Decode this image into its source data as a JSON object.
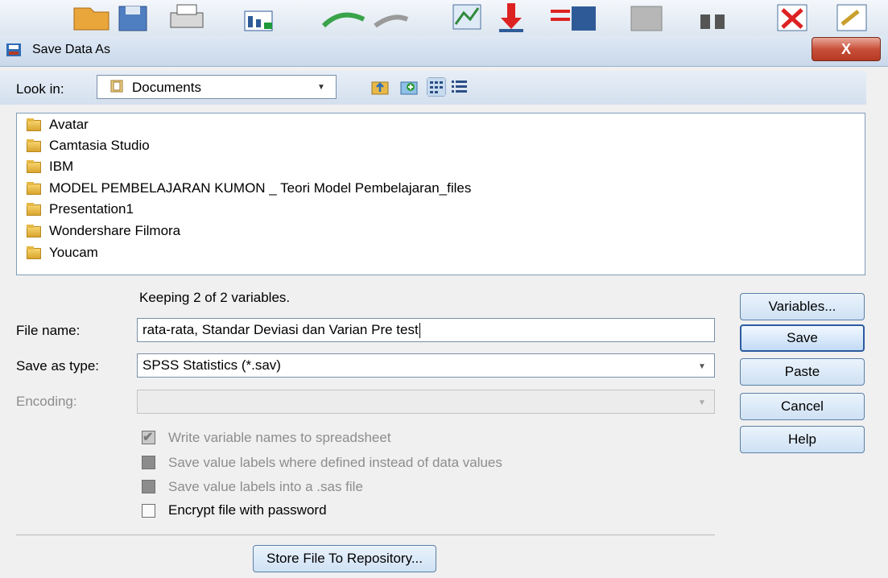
{
  "dialog": {
    "title": "Save Data As",
    "close_label": "X"
  },
  "look_in": {
    "label": "Look in:",
    "value": "Documents"
  },
  "files": [
    {
      "name": "Avatar"
    },
    {
      "name": "Camtasia Studio"
    },
    {
      "name": "IBM"
    },
    {
      "name": "MODEL PEMBELAJARAN KUMON _ Teori Model Pembelajaran_files"
    },
    {
      "name": "Presentation1"
    },
    {
      "name": "Wondershare Filmora"
    },
    {
      "name": "Youcam"
    }
  ],
  "keeping_text": "Keeping 2 of 2 variables.",
  "file_name": {
    "label": "File name:",
    "value": "rata-rata, Standar Deviasi dan Varian Pre test"
  },
  "save_type": {
    "label": "Save as type:",
    "value": "SPSS Statistics (*.sav)"
  },
  "encoding": {
    "label": "Encoding:",
    "value": ""
  },
  "options": {
    "write_names": "Write variable names to spreadsheet",
    "save_value_labels": "Save value labels where defined instead of data values",
    "save_sas_labels": "Save value labels into a .sas file",
    "encrypt": "Encrypt file with password"
  },
  "buttons": {
    "variables": "Variables...",
    "save": "Save",
    "paste": "Paste",
    "cancel": "Cancel",
    "help": "Help",
    "store_repo": "Store File To Repository..."
  },
  "icons": {
    "toolbar": [
      "open-folder-icon",
      "save-icon",
      "print-icon",
      "dialog-recall-icon",
      "undo-icon",
      "redo-icon",
      "goto-case-icon",
      "goto-variable-icon",
      "variables-icon",
      "run-descriptives-icon",
      "find-icon",
      "insert-cases-icon",
      "split-file-icon"
    ],
    "look_in_tools": [
      "up-folder-icon",
      "new-folder-icon",
      "list-view-icon",
      "details-view-icon"
    ]
  },
  "colors": {
    "titlebar": "#c9d8ea",
    "close_button": "#c8503a",
    "button_border": "#5b7fa6"
  }
}
